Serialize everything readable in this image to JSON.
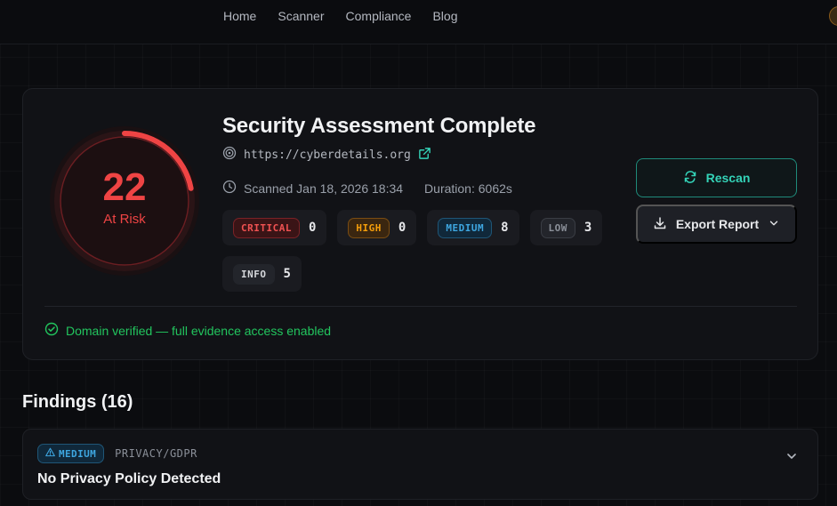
{
  "nav": {
    "links": [
      "Home",
      "Scanner",
      "Compliance",
      "Blog"
    ]
  },
  "summary": {
    "score": "22",
    "score_label": "At Risk",
    "score_fraction": 0.22,
    "title": "Security Assessment Complete",
    "url": "https://cyberdetails.org",
    "scanned": "Scanned Jan 18, 2026 18:34",
    "duration": "Duration: 6062s",
    "severities": [
      {
        "label": "CRITICAL",
        "count": "0",
        "key": "critical"
      },
      {
        "label": "HIGH",
        "count": "0",
        "key": "high"
      },
      {
        "label": "MEDIUM",
        "count": "8",
        "key": "medium"
      },
      {
        "label": "LOW",
        "count": "3",
        "key": "low"
      },
      {
        "label": "INFO",
        "count": "5",
        "key": "info"
      }
    ],
    "rescan_label": "Rescan",
    "export_label": "Export Report",
    "verified_text": "Domain verified — full evidence access enabled"
  },
  "findings": {
    "heading": "Findings (16)",
    "items": [
      {
        "severity": "MEDIUM",
        "category": "PRIVACY/GDPR",
        "title": "No Privacy Policy Detected"
      }
    ]
  },
  "colors": {
    "accent_teal": "#34d3b8",
    "risk_red": "#ef4444",
    "verified_green": "#22c55e"
  },
  "icons": [
    "target-icon",
    "external-link-icon",
    "clock-icon",
    "refresh-icon",
    "download-icon",
    "chevron-down-icon",
    "check-circle-icon",
    "warning-icon"
  ]
}
